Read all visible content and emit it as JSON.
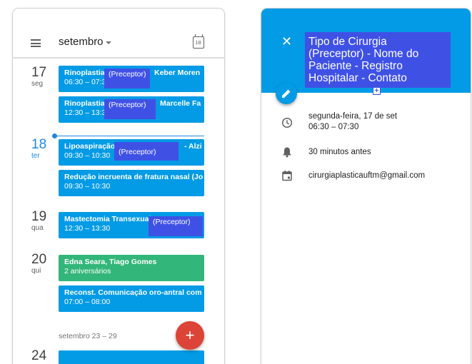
{
  "agenda": {
    "month": "setembro",
    "calendar_icon_day": "18",
    "days": [
      {
        "num": "17",
        "weekday": "seg"
      },
      {
        "num": "18",
        "weekday": "ter"
      },
      {
        "num": "19",
        "weekday": "qua"
      },
      {
        "num": "20",
        "weekday": "qui"
      }
    ],
    "events": [
      {
        "title": "Rinoplastia",
        "tag": "(Preceptor)",
        "suffix": "Keber Moren",
        "time": "06:30 – 07:3"
      },
      {
        "title": "Rinoplastia",
        "tag": "(Preceptor)",
        "suffix": "Marcelle Fa",
        "time": "12:30 – 13:3"
      },
      {
        "title": "Lipoaspiração",
        "tag": "(Preceptor)",
        "suffix": "- Alzi",
        "time": "09:30 – 10:30"
      },
      {
        "title": "Redução incruenta de fratura nasal (Jo",
        "time": "09:30 – 10:30"
      },
      {
        "title": "Mastectomia Transexual",
        "tag": "(Preceptor)",
        "time": "12:30 – 13:30"
      },
      {
        "title": "Edna Seara, Tiago Gomes",
        "time": "2 aniversários"
      },
      {
        "title": "Reconst. Comunicação oro-antral com",
        "time": "07:00 – 08:00"
      }
    ],
    "week_label": "setembro 23 – 29",
    "next_day_partial": "24",
    "fab_label": "+"
  },
  "detail": {
    "title_lines": [
      "Tipo de Cirurgia",
      "(Preceptor) - Nome do",
      "Paciente - Registro",
      "Hospitalar - Contato"
    ],
    "close_label": "✕",
    "plus_label": "+",
    "date": "segunda-feira, 17 de set",
    "time": "06:30 – 07:30",
    "reminder": "30 minutos antes",
    "calendar": "cirurgiaplasticauftm@gmail.com"
  },
  "colors": {
    "event_blue": "#039be5",
    "event_green": "#33b679",
    "tag_indigo": "#3f51e5",
    "fab_red": "#db4437",
    "today_blue": "#1e88e5"
  }
}
